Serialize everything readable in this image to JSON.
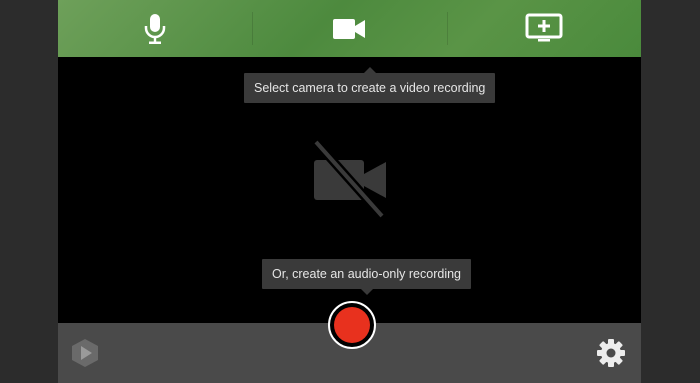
{
  "toolbar": {
    "items": [
      {
        "icon": "microphone-icon",
        "label": "Audio"
      },
      {
        "icon": "video-camera-icon",
        "label": "Camera"
      },
      {
        "icon": "screen-add-icon",
        "label": "Screen"
      }
    ]
  },
  "tooltips": {
    "camera_hint": "Select camera to create a video recording",
    "audio_hint": "Or, create an audio-only recording"
  },
  "preview": {
    "icon": "camera-off-icon"
  },
  "bottom_bar": {
    "logo_icon": "app-logo-icon",
    "record_icon": "record-button",
    "settings_icon": "gear-icon"
  },
  "colors": {
    "toolbar_green": "#5a9446",
    "record_red": "#e8311e",
    "tooltip_bg": "#3a3a3a"
  }
}
